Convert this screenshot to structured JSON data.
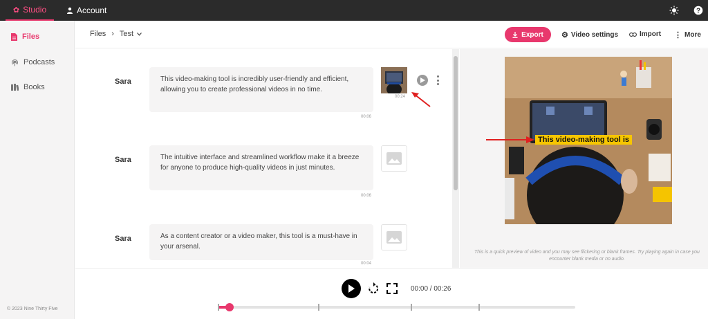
{
  "topbar": {
    "studio_label": "Studio",
    "account_label": "Account",
    "theme_icon": "sun-icon",
    "help_icon": "help-icon"
  },
  "sidebar": {
    "items": [
      {
        "label": "Files",
        "icon": "file-icon",
        "active": true
      },
      {
        "label": "Podcasts",
        "icon": "podcast-icon",
        "active": false
      },
      {
        "label": "Books",
        "icon": "book-icon",
        "active": false
      }
    ],
    "footer": "© 2023 Nine Thirty Five"
  },
  "header": {
    "breadcrumb_root": "Files",
    "breadcrumb_sep": "›",
    "breadcrumb_current": "Test",
    "export_label": "Export",
    "video_settings_label": "Video settings",
    "import_label": "Import",
    "more_label": "More"
  },
  "transcript": {
    "rows": [
      {
        "speaker": "Sara",
        "text": "This video-making tool is incredibly user-friendly and efficient, allowing you to create professional videos in no time.",
        "timestamp": "00:06",
        "media_duration": "00:24"
      },
      {
        "speaker": "Sara",
        "text": "The intuitive interface and streamlined workflow make it a breeze for anyone to produce high-quality videos in just minutes.",
        "timestamp": "00:06"
      },
      {
        "speaker": "Sara",
        "text": "As a content creator or a video maker, this tool is a must-have in your arsenal.",
        "timestamp": "00:04"
      }
    ]
  },
  "preview": {
    "caption": "This video-making tool is",
    "note": "This is a quick preview of video and you may see flickering or blank frames. Try playing again in case you encounter blank media or no audio."
  },
  "player": {
    "time": "00:00 / 00:26",
    "progress": 0.02,
    "segment_marks": [
      0.28,
      0.54,
      0.73
    ]
  },
  "colors": {
    "accent": "#e8386d",
    "topbar_bg": "#2b2b2b",
    "caption_bg": "#f7c600",
    "annotation_arrow": "#e02020"
  }
}
